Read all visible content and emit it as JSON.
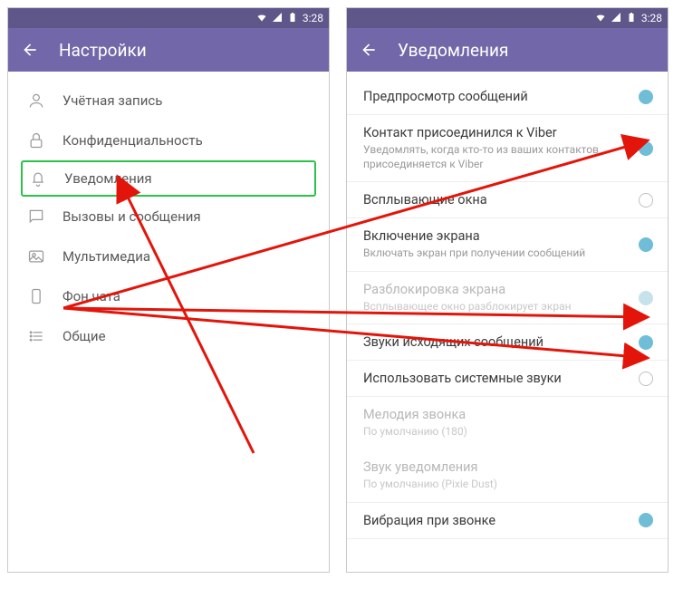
{
  "statusbar": {
    "time": "3:28"
  },
  "left": {
    "title": "Настройки",
    "items": [
      {
        "label": "Учётная запись"
      },
      {
        "label": "Конфиденциальность"
      },
      {
        "label": "Уведомления"
      },
      {
        "label": "Вызовы и сообщения"
      },
      {
        "label": "Мультимедиа"
      },
      {
        "label": "Фон чата"
      },
      {
        "label": "Общие"
      }
    ]
  },
  "right": {
    "title": "Уведомления",
    "settings": [
      {
        "title": "Предпросмотр сообщений",
        "subtitle": "",
        "state": "on"
      },
      {
        "title": "Контакт присоединился к Viber",
        "subtitle": "Уведомлять, когда кто-то из ваших контактов присоединяется к Viber",
        "state": "on"
      },
      {
        "title": "Всплывающие окна",
        "subtitle": "",
        "state": "off"
      },
      {
        "title": "Включение экрана",
        "subtitle": "Включать экран при получении сообщений",
        "state": "on"
      },
      {
        "title": "Разблокировка экрана",
        "subtitle": "Всплывающее окно разблокирует экран",
        "state": "on-disabled"
      },
      {
        "title": "Звуки исходящих сообщений",
        "subtitle": "",
        "state": "on"
      },
      {
        "title": "Использовать системные звуки",
        "subtitle": "",
        "state": "off"
      },
      {
        "title": "Мелодия звонка",
        "subtitle": "По умолчанию (180)",
        "state": ""
      },
      {
        "title": "Звук уведомления",
        "subtitle": "По умолчанию (Pixie Dust)",
        "state": ""
      },
      {
        "title": "Вибрация при звонке",
        "subtitle": "",
        "state": "on"
      }
    ]
  }
}
